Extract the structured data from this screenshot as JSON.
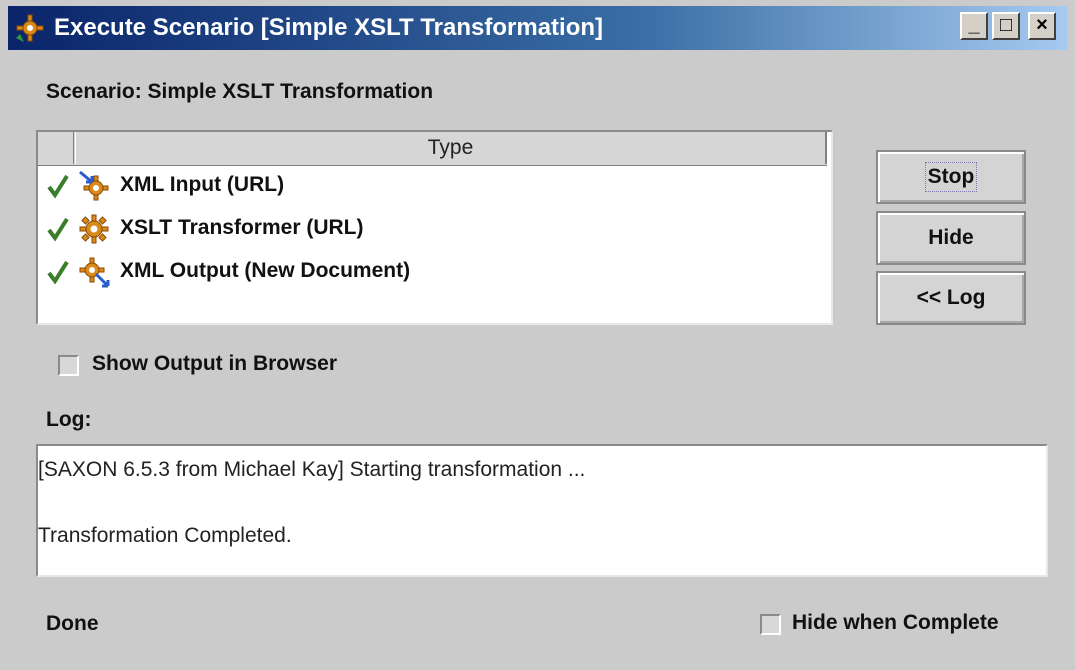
{
  "window": {
    "title": "Execute Scenario [Simple XSLT Transformation]",
    "controls": {
      "minimize": "_",
      "maximize": "□",
      "close": "×"
    }
  },
  "scenario_label": "Scenario: Simple XSLT Transformation",
  "steps_table": {
    "header": {
      "type": "Type"
    },
    "rows": [
      {
        "status": "completed",
        "icon": "xml-input-icon",
        "label": "XML Input (URL)"
      },
      {
        "status": "completed",
        "icon": "xslt-transformer-icon",
        "label": "XSLT Transformer (URL)"
      },
      {
        "status": "completed",
        "icon": "xml-output-icon",
        "label": "XML Output (New Document)"
      }
    ]
  },
  "buttons": {
    "stop": "Stop",
    "hide": "Hide",
    "log": "<< Log"
  },
  "show_output_in_browser": {
    "label": "Show Output in Browser",
    "checked": false
  },
  "log": {
    "label": "Log:",
    "lines": [
      "[SAXON 6.5.3 from Michael Kay] Starting transformation ...",
      "Transformation Completed."
    ]
  },
  "status_text": "Done",
  "hide_when_complete": {
    "label": "Hide when Complete",
    "checked": false
  },
  "colors": {
    "titlebar_start": "#0a246a",
    "titlebar_end": "#a6caf0",
    "check_green": "#3a7d2a",
    "gear_orange": "#d98a1a",
    "arrow_blue": "#2a5bd0"
  }
}
